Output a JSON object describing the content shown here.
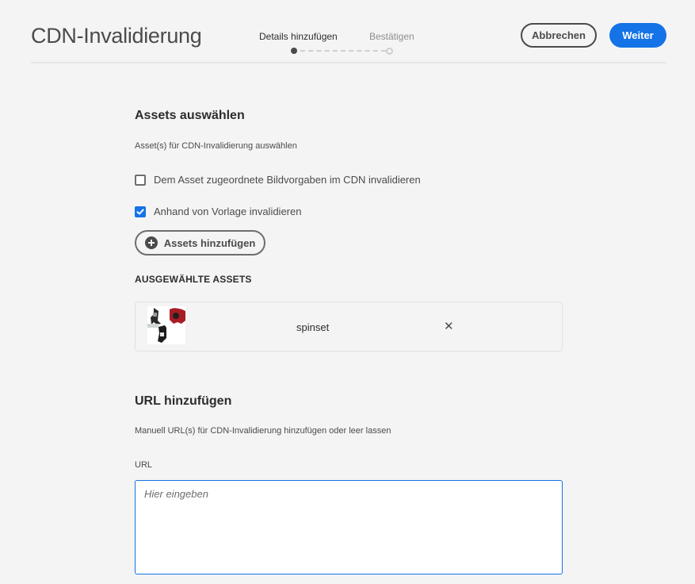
{
  "header": {
    "title": "CDN-Invalidierung",
    "steps": [
      {
        "label": "Details hinzufügen",
        "state": "active"
      },
      {
        "label": "Bestätigen",
        "state": "pending"
      }
    ],
    "cancel_label": "Abbrechen",
    "next_label": "Weiter"
  },
  "assets_section": {
    "title": "Assets auswählen",
    "description": "Asset(s) für CDN-Invalidierung auswählen",
    "options": [
      {
        "label": "Dem Asset zugeordnete Bildvorgaben im CDN invalidieren",
        "checked": false
      },
      {
        "label": "Anhand von Vorlage invalidieren",
        "checked": true
      }
    ],
    "add_button_label": "Assets hinzufügen",
    "selected_heading": "AUSGEWÄHLTE ASSETS",
    "selected": [
      {
        "name": "spinset",
        "thumbnail_icon": "spinset-thumbnail"
      }
    ]
  },
  "url_section": {
    "title": "URL hinzufügen",
    "description": "Manuell URL(s) für CDN-Invalidierung hinzufügen oder leer lassen",
    "field_label": "URL",
    "placeholder": "Hier eingeben",
    "value": ""
  },
  "colors": {
    "accent": "#1473e6",
    "background": "#f4f4f4",
    "text": "#2c2c2c"
  }
}
